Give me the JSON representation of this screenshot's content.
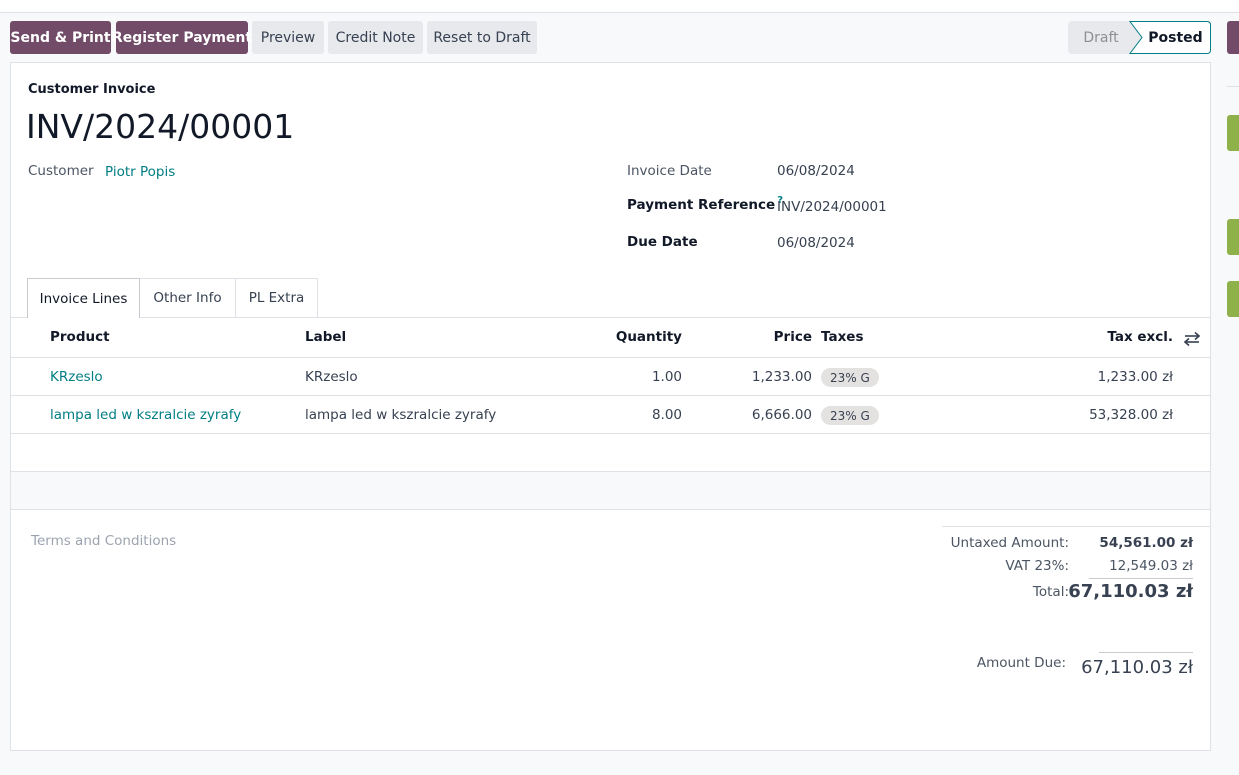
{
  "toolbar": {
    "send_print": "Send & Print",
    "register_payment": "Register Payment",
    "preview": "Preview",
    "credit_note": "Credit Note",
    "reset_draft": "Reset to Draft"
  },
  "status": {
    "draft": "Draft",
    "posted": "Posted",
    "current": "Posted"
  },
  "invoice": {
    "subtitle": "Customer Invoice",
    "name": "INV/2024/00001",
    "customer_label": "Customer",
    "customer_value": "Piotr Popis",
    "invoice_date_label": "Invoice Date",
    "invoice_date": "06/08/2024",
    "payment_ref_label": "Payment Reference",
    "payment_ref_help": "?",
    "payment_ref": "INV/2024/00001",
    "due_date_label": "Due Date",
    "due_date": "06/08/2024"
  },
  "tabs": [
    "Invoice Lines",
    "Other Info",
    "PL Extra"
  ],
  "columns": {
    "product": "Product",
    "label": "Label",
    "quantity": "Quantity",
    "price": "Price",
    "taxes": "Taxes",
    "tax_excl": "Tax excl."
  },
  "lines": [
    {
      "product": "KRzeslo",
      "label": "KRzeslo",
      "quantity": "1.00",
      "price": "1,233.00",
      "tax": "23% G",
      "subtotal": "1,233.00 zł"
    },
    {
      "product": "lampa led w kszralcie zyrafy",
      "label": "lampa led w kszralcie zyrafy",
      "quantity": "8.00",
      "price": "6,666.00",
      "tax": "23% G",
      "subtotal": "53,328.00 zł"
    }
  ],
  "terms_placeholder": "Terms and Conditions",
  "totals": {
    "untaxed_label": "Untaxed Amount:",
    "untaxed": "54,561.00 zł",
    "vat_label": "VAT 23%:",
    "vat": "12,549.03 zł",
    "total_label": "Total:",
    "total": "67,110.03 zł",
    "due_label": "Amount Due:",
    "due": "67,110.03 zł"
  },
  "colors": {
    "primary": "#714b67",
    "link": "#017e84",
    "accent_green": "#8fb14a"
  }
}
